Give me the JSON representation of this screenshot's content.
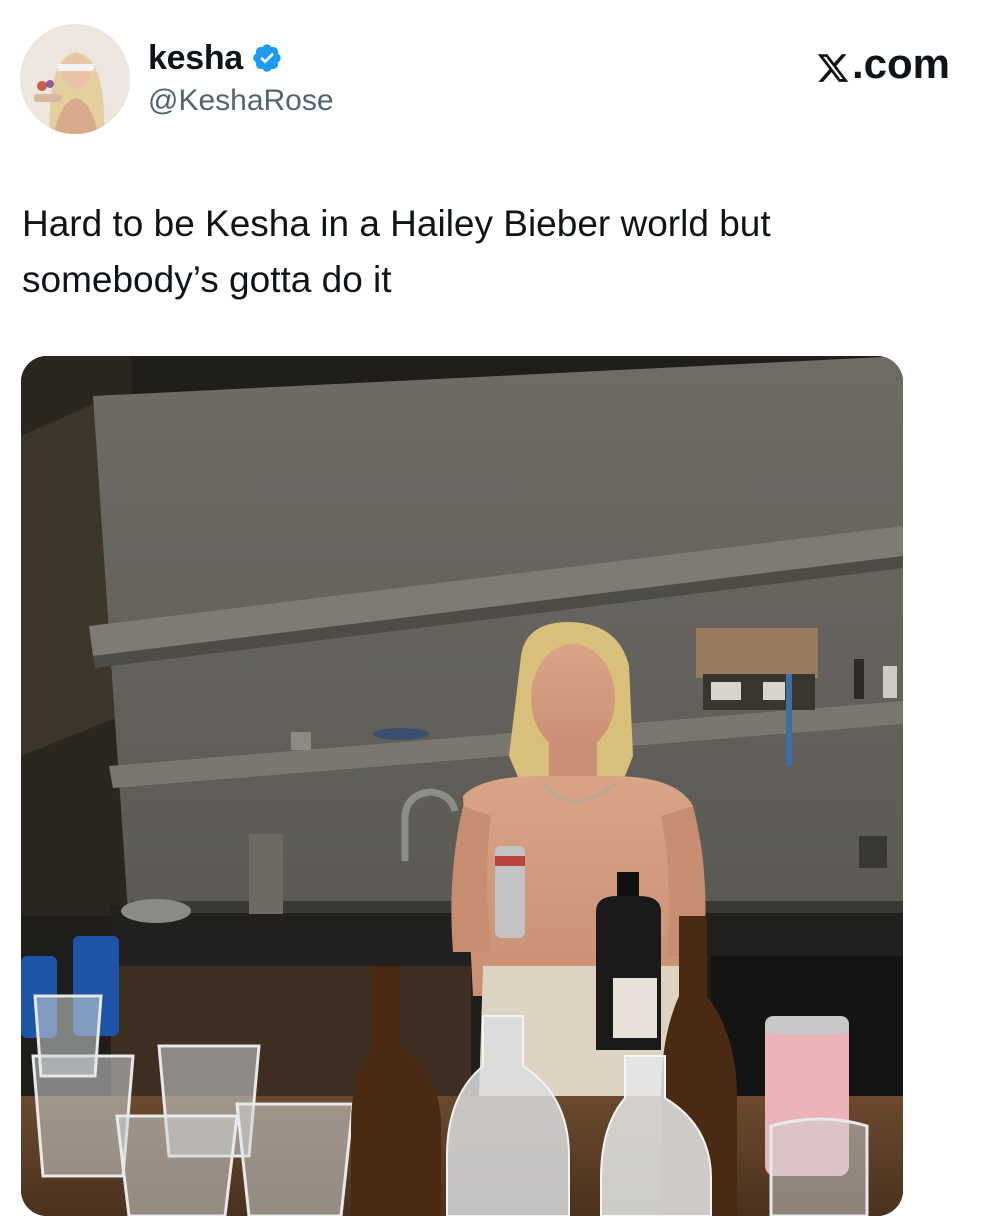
{
  "post": {
    "author": {
      "display_name": "kesha",
      "handle": "@KeshaRose",
      "verified": true
    },
    "site": {
      "logo_text": ".com",
      "logo_icon": "x-logo-icon"
    },
    "text": "Hard to be Kesha in a Hailey Bieber world but somebody’s gotta do it",
    "media": {
      "type": "photo",
      "icon": "photo"
    }
  },
  "colors": {
    "text": "#0f1419",
    "secondary_text": "#536471",
    "verified_blue": "#1d9bf0",
    "background": "#ffffff"
  }
}
